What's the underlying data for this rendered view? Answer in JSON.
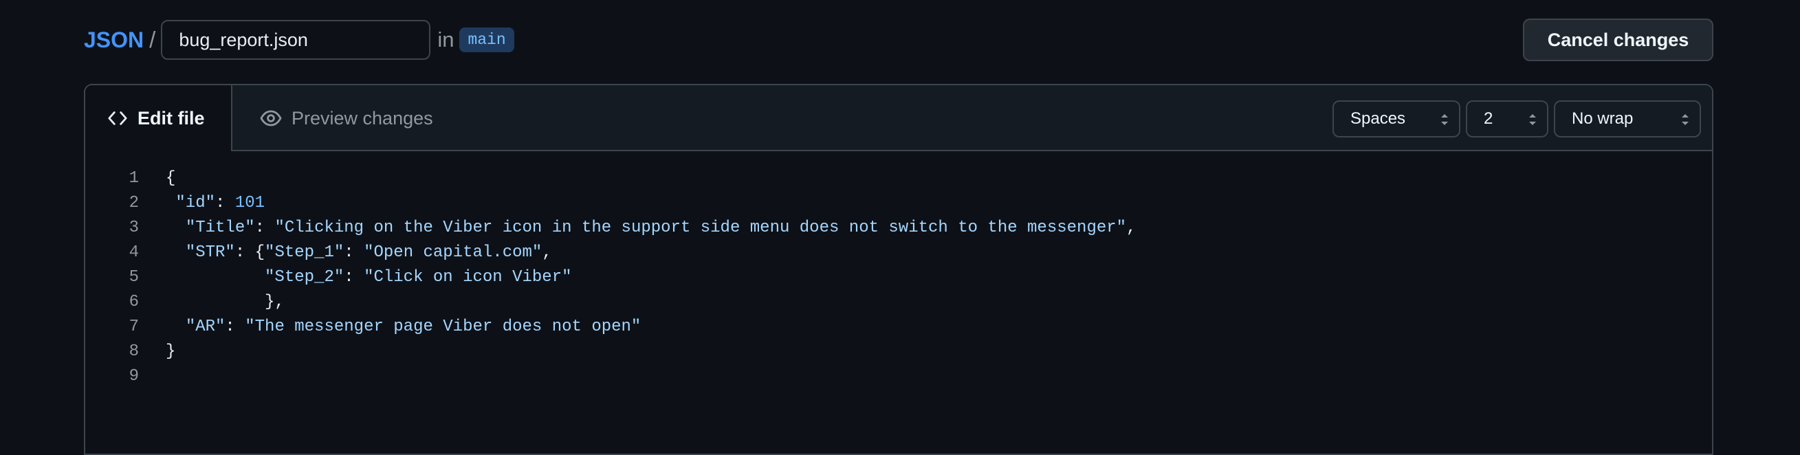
{
  "breadcrumb": {
    "repo": "JSON",
    "separator": "/",
    "filename": "bug_report.json",
    "in_label": "in",
    "branch": "main"
  },
  "header": {
    "cancel_label": "Cancel changes"
  },
  "editor": {
    "tabs": [
      {
        "label": "Edit file",
        "icon": "code-icon",
        "active": true
      },
      {
        "label": "Preview changes",
        "icon": "eye-icon",
        "active": false
      }
    ],
    "indent_mode": "Spaces",
    "indent_size": "2",
    "wrap_mode": "No wrap",
    "lines": [
      {
        "num": "1",
        "text": "{"
      },
      {
        "num": "2",
        "text": " \"id\": 101"
      },
      {
        "num": "3",
        "text": "  \"Title\": \"Clicking on the Viber icon in the support side menu does not switch to the messenger\","
      },
      {
        "num": "4",
        "text": "  \"STR\": {\"Step_1\": \"Open capital.com\","
      },
      {
        "num": "5",
        "text": "          \"Step_2\": \"Click on icon Viber\""
      },
      {
        "num": "6",
        "text": "          },"
      },
      {
        "num": "7",
        "text": "  \"AR\": \"The messenger page Viber does not open\""
      },
      {
        "num": "8",
        "text": "}"
      },
      {
        "num": "9",
        "text": ""
      }
    ]
  },
  "colors": {
    "background": "#0d1117",
    "accent": "#4493f8",
    "border": "#3d444d"
  }
}
